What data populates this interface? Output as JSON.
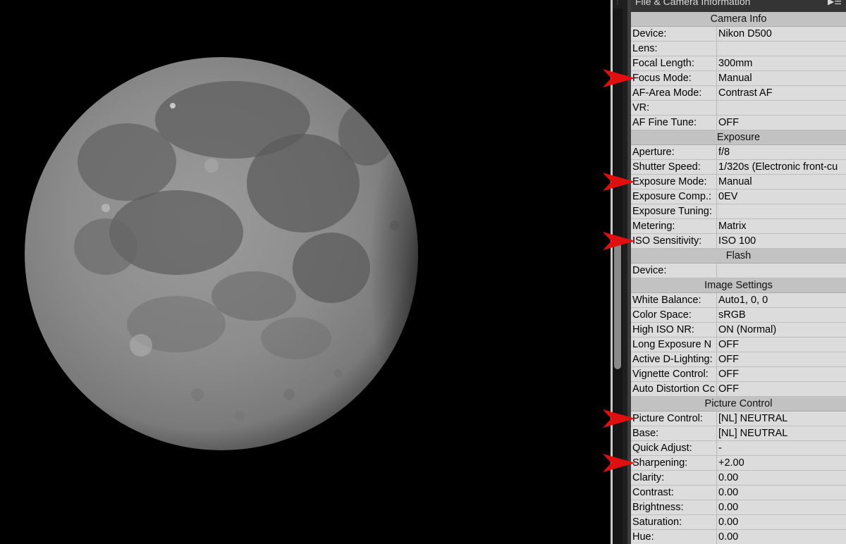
{
  "panel": {
    "title": "File & Camera Information",
    "menu_icon": "list-menu-icon",
    "sections": [
      {
        "title": "Camera Info",
        "rows": [
          {
            "label": "Device:",
            "value": "Nikon D500"
          },
          {
            "label": "Lens:",
            "value": ""
          },
          {
            "label": "Focal Length:",
            "value": "300mm"
          },
          {
            "label": "Focus Mode:",
            "value": "Manual"
          },
          {
            "label": "AF-Area Mode:",
            "value": "Contrast AF"
          },
          {
            "label": "VR:",
            "value": ""
          },
          {
            "label": "AF Fine Tune:",
            "value": "OFF"
          }
        ]
      },
      {
        "title": "Exposure",
        "rows": [
          {
            "label": "Aperture:",
            "value": "f/8"
          },
          {
            "label": "Shutter Speed:",
            "value": "1/320s (Electronic front-cu"
          },
          {
            "label": "Exposure Mode:",
            "value": "Manual"
          },
          {
            "label": "Exposure Comp.:",
            "value": "0EV"
          },
          {
            "label": "Exposure Tuning:",
            "value": ""
          },
          {
            "label": "Metering:",
            "value": "Matrix"
          },
          {
            "label": "ISO Sensitivity:",
            "value": "ISO 100"
          }
        ]
      },
      {
        "title": "Flash",
        "rows": [
          {
            "label": "Device:",
            "value": ""
          }
        ]
      },
      {
        "title": "Image Settings",
        "rows": [
          {
            "label": "White Balance:",
            "value": "Auto1, 0, 0"
          },
          {
            "label": "Color Space:",
            "value": "sRGB"
          },
          {
            "label": "High ISO NR:",
            "value": "ON (Normal)"
          },
          {
            "label": "Long Exposure N",
            "value": "OFF"
          },
          {
            "label": "Active D-Lighting:",
            "value": "OFF"
          },
          {
            "label": "Vignette Control:",
            "value": "OFF"
          },
          {
            "label": "Auto Distortion Cc",
            "value": "OFF"
          }
        ]
      },
      {
        "title": "Picture Control",
        "rows": [
          {
            "label": "Picture Control:",
            "value": "[NL] NEUTRAL"
          },
          {
            "label": "Base:",
            "value": "[NL] NEUTRAL"
          },
          {
            "label": "Quick Adjust:",
            "value": "-"
          },
          {
            "label": "Sharpening:",
            "value": "+2.00"
          },
          {
            "label": "Clarity:",
            "value": " 0.00"
          },
          {
            "label": "Contrast:",
            "value": " 0.00"
          },
          {
            "label": "Brightness:",
            "value": " 0.00"
          },
          {
            "label": "Saturation:",
            "value": " 0.00"
          },
          {
            "label": "Hue:",
            "value": " 0.00"
          }
        ]
      }
    ]
  },
  "annotations": {
    "arrow_color": "#e01010",
    "marked_rows": [
      "Focus Mode:",
      "Exposure Mode:",
      "ISO Sensitivity:",
      "Picture Control:",
      "Sharpening:"
    ]
  },
  "image": {
    "subject_icon": "moon-photo"
  }
}
